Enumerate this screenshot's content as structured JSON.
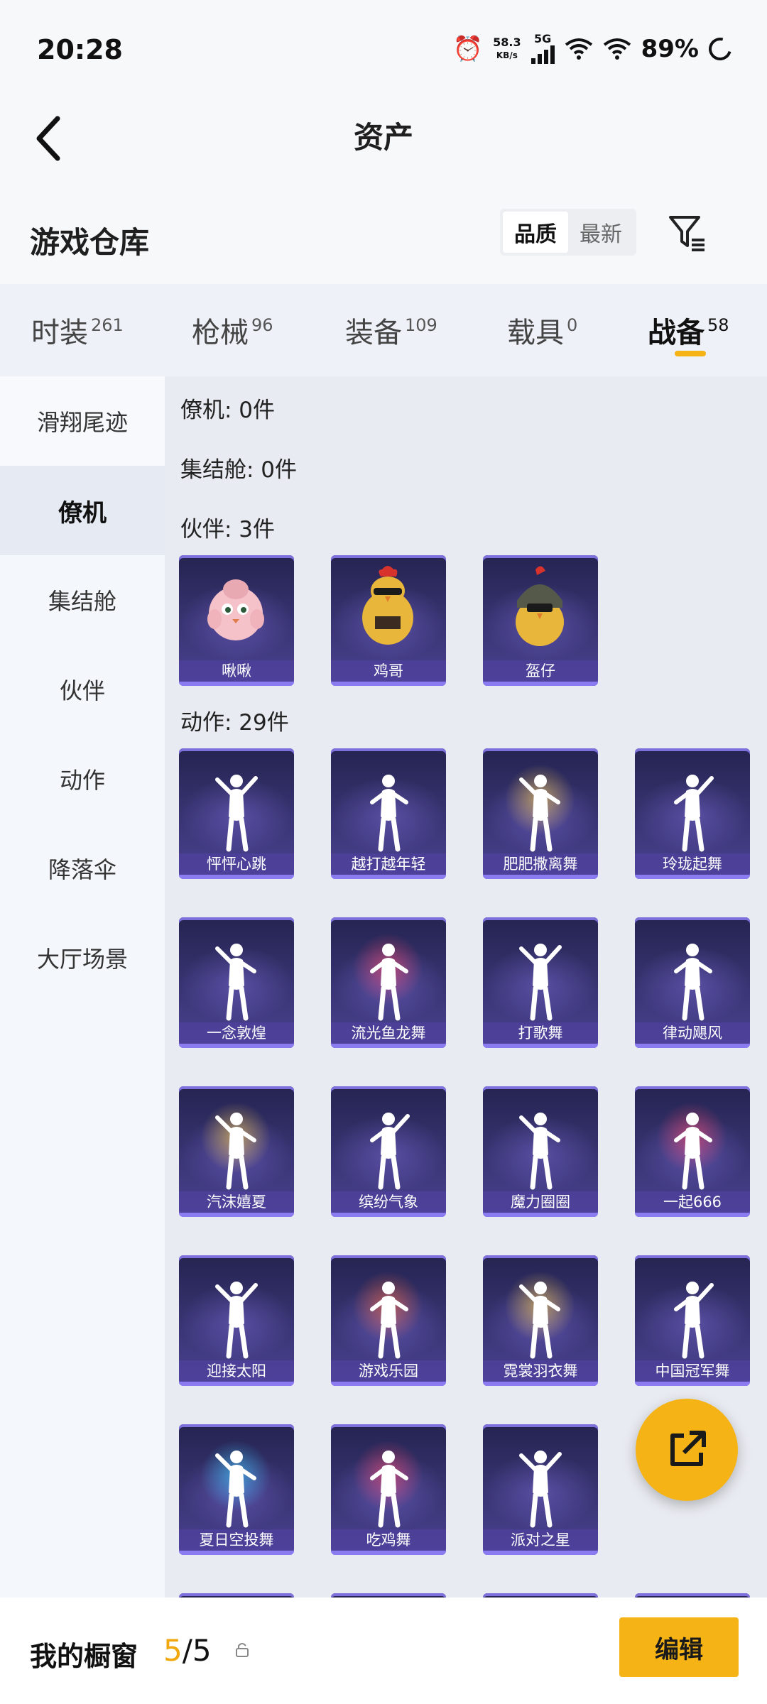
{
  "status": {
    "time": "20:28",
    "net_speed_value": "58.3",
    "net_speed_unit": "KB/s",
    "network": "5G",
    "battery": "89%"
  },
  "header": {
    "title": "资产",
    "back_icon": "chevron-left-icon"
  },
  "section": {
    "title": "游戏仓库",
    "sort": {
      "quality": "品质",
      "newest": "最新"
    },
    "filter_icon": "filter-icon"
  },
  "tabs": [
    {
      "label": "时装",
      "count": "261"
    },
    {
      "label": "枪械",
      "count": "96"
    },
    {
      "label": "装备",
      "count": "109"
    },
    {
      "label": "载具",
      "count": "0"
    },
    {
      "label": "战备",
      "count": "58"
    }
  ],
  "sidebar": [
    {
      "label": "滑翔尾迹"
    },
    {
      "label": "僚机"
    },
    {
      "label": "集结舱"
    },
    {
      "label": "伙伴"
    },
    {
      "label": "动作"
    },
    {
      "label": "降落伞"
    },
    {
      "label": "大厅场景"
    }
  ],
  "groups": {
    "wingman": "僚机: 0件",
    "assembly": "集结舱: 0件",
    "partners": "伙伴: 3件",
    "actions": "动作: 29件"
  },
  "partners": [
    "啾啾",
    "鸡哥",
    "盔仔"
  ],
  "actions": [
    "怦怦心跳",
    "越打越年轻",
    "肥肥撒离舞",
    "玲珑起舞",
    "一念敦煌",
    "流光鱼龙舞",
    "打歌舞",
    "律动飓风",
    "汽沫嬉夏",
    "缤纷气象",
    "魔力圈圈",
    "一起666",
    "迎接太阳",
    "游戏乐园",
    "霓裳羽衣舞",
    "中国冠军舞",
    "夏日空投舞",
    "吃鸡舞",
    "派对之星"
  ],
  "bottom": {
    "window_label": "我的橱窗",
    "count_current": "5",
    "count_total": "/5",
    "edit_label": "编辑"
  },
  "colors": {
    "accent": "#f5b316",
    "card_top": "#252451",
    "card_bottom": "#4b4393"
  }
}
